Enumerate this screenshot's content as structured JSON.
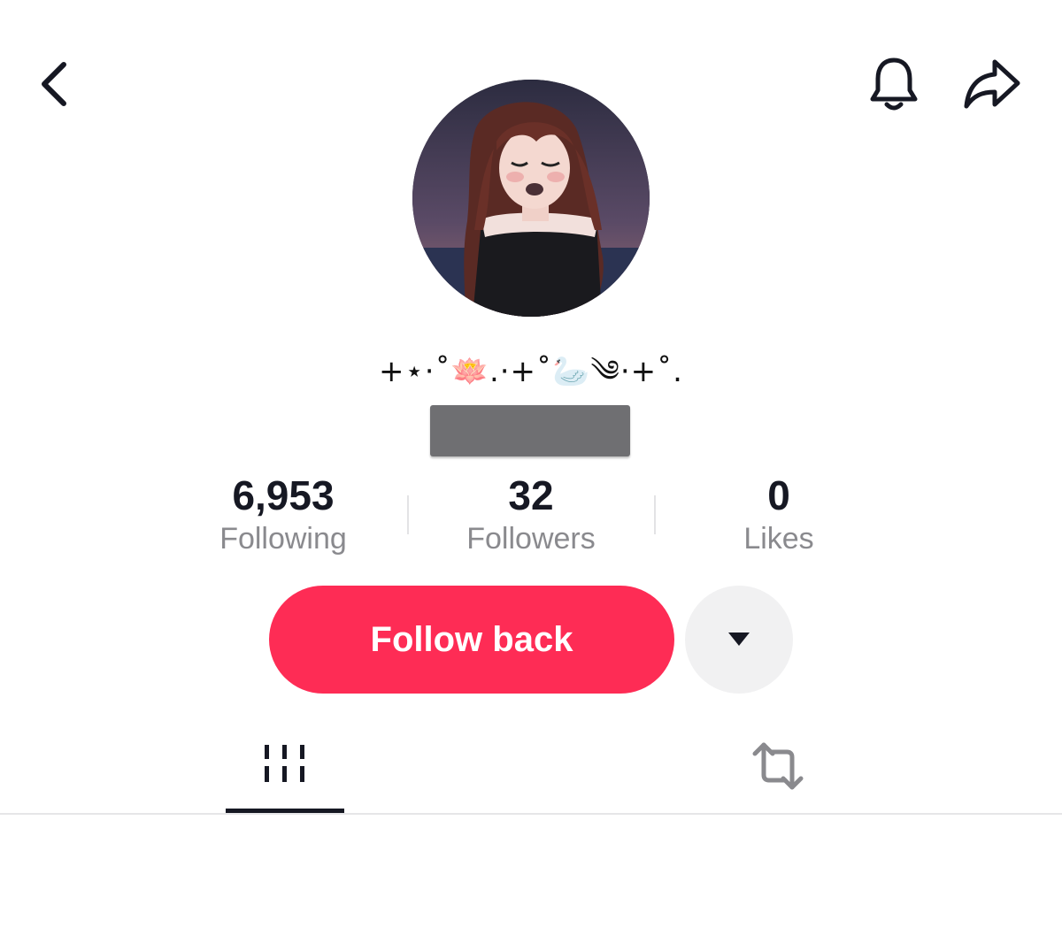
{
  "header": {
    "back_icon": "chevron-left-icon",
    "notification_icon": "bell-icon",
    "share_icon": "share-arrow-icon"
  },
  "profile": {
    "nickname": "+⋆·˚🪷.·+˚🦢༄·+˚."
  },
  "stats": {
    "following": {
      "value": "6,953",
      "label": "Following"
    },
    "followers": {
      "value": "32",
      "label": "Followers"
    },
    "likes": {
      "value": "0",
      "label": "Likes"
    }
  },
  "actions": {
    "follow_label": "Follow back",
    "follow_color": "#fe2c55",
    "dropdown_icon": "triangle-down-icon"
  },
  "tabs": [
    {
      "icon": "grid-videos-icon",
      "active": true
    },
    {
      "icon": "repost-icon",
      "active": false
    }
  ]
}
